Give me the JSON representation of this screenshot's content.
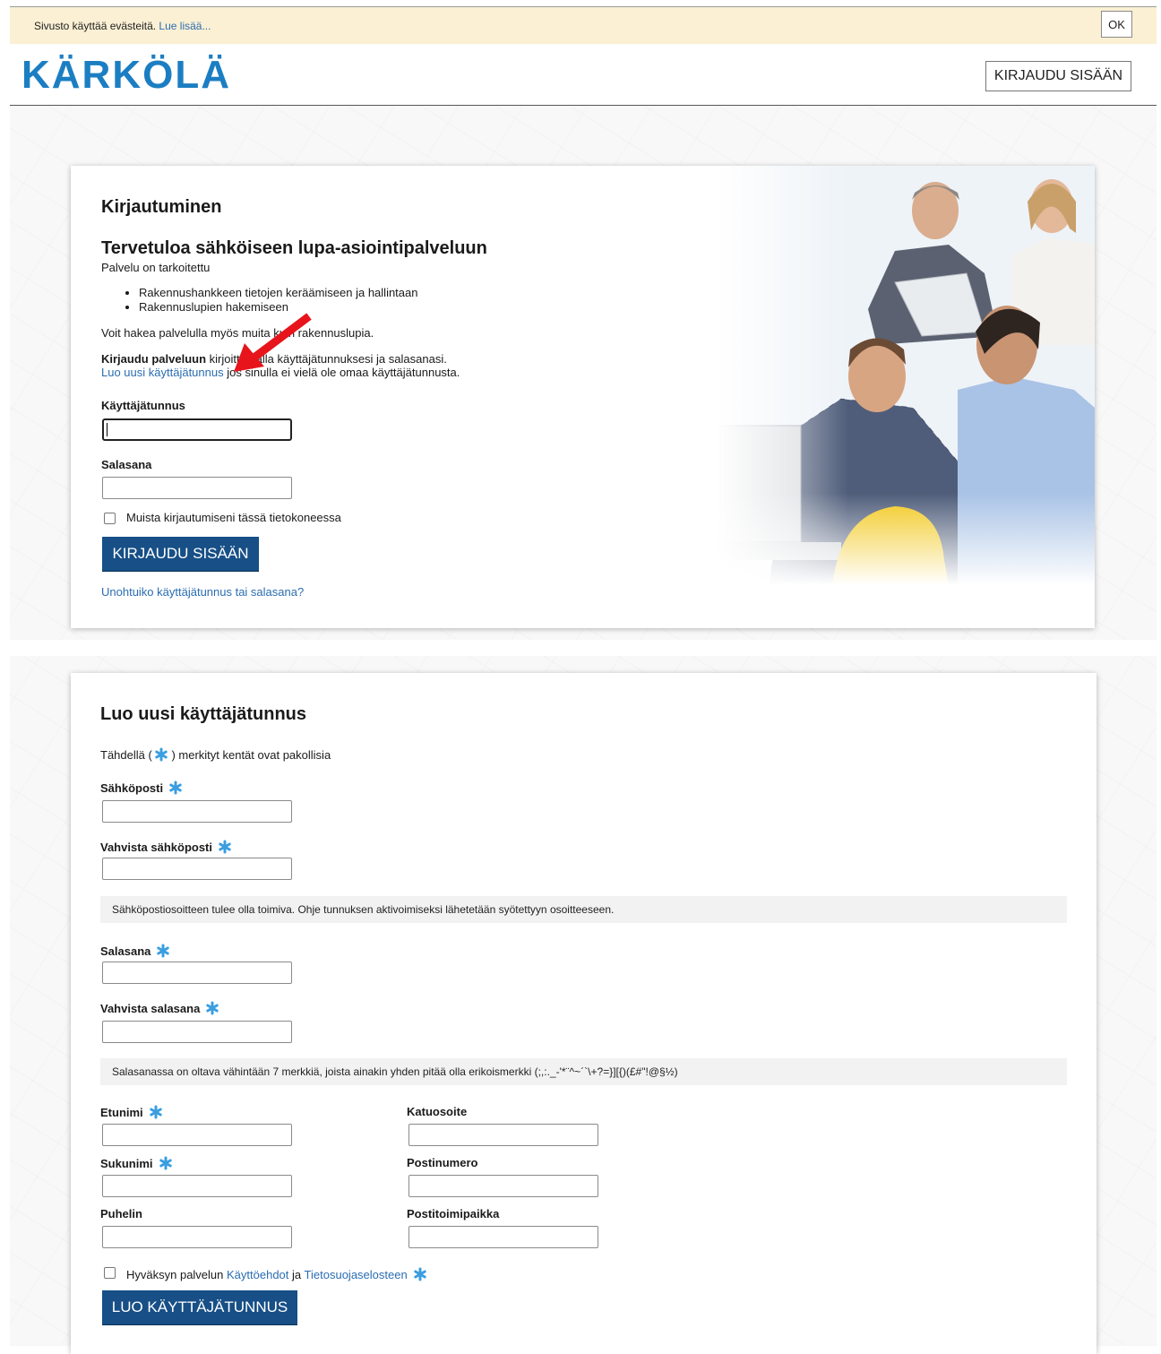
{
  "cookie_bar": {
    "text": "Sivusto käyttää evästeitä.",
    "read_more": "Lue lisää...",
    "ok": "OK"
  },
  "header": {
    "logo": "KÄRKÖLÄ",
    "login_button": "KIRJAUDU SISÄÄN"
  },
  "login": {
    "title": "Kirjautuminen",
    "welcome": "Tervetuloa sähköiseen lupa-asiointipalveluun",
    "intro": "Palvelu on tarkoitettu",
    "bullets": [
      "Rakennushankkeen tietojen keräämiseen ja hallintaan",
      "Rakennuslupien hakemiseen"
    ],
    "other_permits": "Voit hakea palvelulla myös muita kuin rakennuslupia.",
    "instruction_bold": "Kirjaudu palveluun",
    "instruction_rest": " kirjoittamalla käyttäjätunnuksesi ja salasanasi.",
    "create_link": "Luo uusi käyttäjätunnus",
    "create_rest": " jos sinulla ei vielä ole omaa käyttäjätunnusta.",
    "username_label": "Käyttäjätunnus",
    "username_value": "",
    "password_label": "Salasana",
    "password_value": "",
    "remember_label": "Muista kirjautumiseni tässä tietokoneessa",
    "remember_checked": false,
    "submit": "KIRJAUDU SISÄÄN",
    "forgot": "Unohtuiko käyttäjätunnus tai salasana?"
  },
  "register": {
    "title": "Luo uusi käyttäjätunnus",
    "required_prefix": "Tähdellä (",
    "required_suffix": ") merkityt kentät ovat pakollisia",
    "email_label": "Sähköposti",
    "confirm_email_label": "Vahvista sähköposti",
    "email_note": "Sähköpostiosoitteen tulee olla toimiva. Ohje tunnuksen aktivoimiseksi lähetetään syötettyyn osoitteeseen.",
    "password_label": "Salasana",
    "confirm_password_label": "Vahvista salasana",
    "password_note": "Salasanassa on oltava vähintään 7 merkkiä, joista ainakin yhden pitää olla erikoismerkki (;,:._-'*¨^~´`\\+?=}][{)(£#\"!@§½)",
    "firstname_label": "Etunimi",
    "lastname_label": "Sukunimi",
    "phone_label": "Puhelin",
    "street_label": "Katuosoite",
    "postcode_label": "Postinumero",
    "city_label": "Postitoimipaikka",
    "accept_prefix": "Hyväksyn palvelun",
    "terms_link": "Käyttöehdot",
    "accept_and": "ja",
    "privacy_link": "Tietosuojaselosteen",
    "accept_checked": false,
    "submit": "LUO KÄYTTÄJÄTUNNUS"
  },
  "colors": {
    "brand": "#1c7ec2",
    "primary_button": "#174f86",
    "link": "#2b6db1",
    "cookie_bg": "#fbf0d4",
    "required_star": "#3a9ee0",
    "annotation_arrow": "#e8141b"
  },
  "icons": {
    "required": "asterisk-icon",
    "annotation": "red-arrow-icon"
  }
}
